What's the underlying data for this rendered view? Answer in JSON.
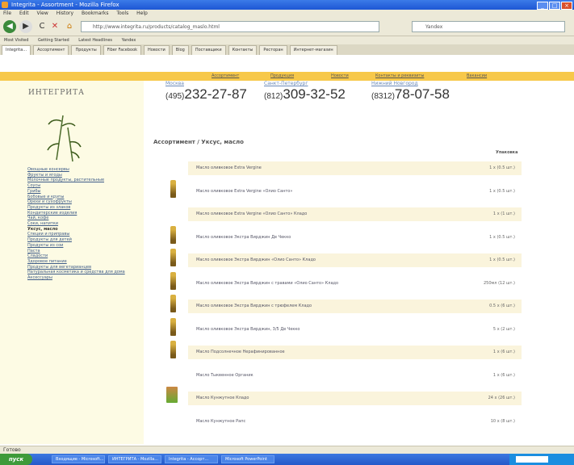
{
  "window": {
    "title": "Integrita - Assortment - Mozilla Firefox"
  },
  "menu": {
    "items": [
      "File",
      "Edit",
      "View",
      "History",
      "Bookmarks",
      "Tools",
      "Help"
    ]
  },
  "toolbar": {
    "back": "◀",
    "forward": "▶",
    "reload": "C",
    "stop": "✕",
    "home": "⌂",
    "url": "http://www.integrita.ru/products/catalog_maslo.html",
    "search_placeholder": "Yandex"
  },
  "bookmarks": [
    "Most Visited",
    "Getting Started",
    "Latest Headlines",
    "Yandex"
  ],
  "tabs": [
    "Integrita...",
    "Ассортимент",
    "Продукты",
    "Fiber Facebook",
    "Новости",
    "Blog",
    "Поставщики",
    "Контакты",
    "Ресторан",
    "Интернет-магазин"
  ],
  "sitenav": [
    "Ассортимент",
    "Продукция",
    "Новости",
    "Контакты и реквизиты",
    "Вакансии"
  ],
  "sidebar": {
    "logo": "ИНТЕГРИТА",
    "categories": [
      "Овощные консервы",
      "Фрукты и ягоды",
      "Молочные продукты, растительные",
      "Соусы",
      "Грибы",
      "Бобовые и крупы",
      "Орехи и сухофрукты",
      "Продукты из злаков",
      "Кондитерские изделия",
      "Чай, кофе",
      "Соки, напитки",
      "Уксус, масло",
      "Специи и приправы",
      "Продукты для детей",
      "Продукты из сои",
      "Паста",
      "Сладости",
      "Здоровое питание",
      "Продукты для вегетарианцев",
      "Натуральная косметика и средства для дома",
      "Аксессуары"
    ],
    "active_index": 11
  },
  "phones": [
    {
      "city": "Москва",
      "code": "(495)",
      "number": "232-27-87"
    },
    {
      "city": "Санкт-Петербург",
      "code": "(812)",
      "number": "309-32-52"
    },
    {
      "city": "Нижний Новгород",
      "code": "(8312)",
      "number": "78-07-58"
    }
  ],
  "breadcrumb": "Ассортимент / Уксус, масло",
  "table": {
    "pack_header": "Упаковка",
    "rows": [
      {
        "name": "Масло оливковое Extra Vergine",
        "pack": "1 x (0.5 шт.)"
      },
      {
        "name": "Масло оливковое Extra Vergine «Олио Санто»",
        "pack": "1 x (0.5 шт.)"
      },
      {
        "name": "Масло оливковое Extra Vergine «Олио Санто» Кладо",
        "pack": "1 x (1 шт.)"
      },
      {
        "name": "Масло оливковое Экстра Вирджин Де Чекко",
        "pack": "1 x (0.5 шт.)"
      },
      {
        "name": "Масло оливковое Экстра Вирджин «Олио Санто» Кладо",
        "pack": "1 x (0.5 шт.)"
      },
      {
        "name": "Масло оливковое Экстра Вирджин с травами «Олио Санто» Кладо",
        "pack": "250мл (12 шт.)"
      },
      {
        "name": "Масло оливковое Экстра Вирджин с трюфелем Кладо",
        "pack": "0.5 x (6 шт.)"
      },
      {
        "name": "Масло оливковое Экстра Вирджин, 3/5 Де Чекко",
        "pack": "5 x (2 шт.)"
      },
      {
        "name": "Масло Подсолнечное Нерафинированное",
        "pack": "1 x (6 шт.)"
      },
      {
        "name": "Масло Тыквенное Органик",
        "pack": "1 x (6 шт.)"
      },
      {
        "name": "Масло Кунжутное Кладо",
        "pack": "24 x (26 шт.)"
      },
      {
        "name": "Масло Кунжутное Рапс",
        "pack": "10 x (8 шт.)"
      }
    ],
    "images_at": [
      1,
      3,
      4,
      5,
      6,
      7,
      8,
      10
    ]
  },
  "status": {
    "text": "Готово"
  },
  "taskbar": {
    "start": "пуск",
    "items": [
      "Входящие - Microsoft...",
      "ИНТЕГРИТА - Mozilla...",
      "Integrita - Ассорт...",
      "Microsoft PowerPoint"
    ]
  }
}
